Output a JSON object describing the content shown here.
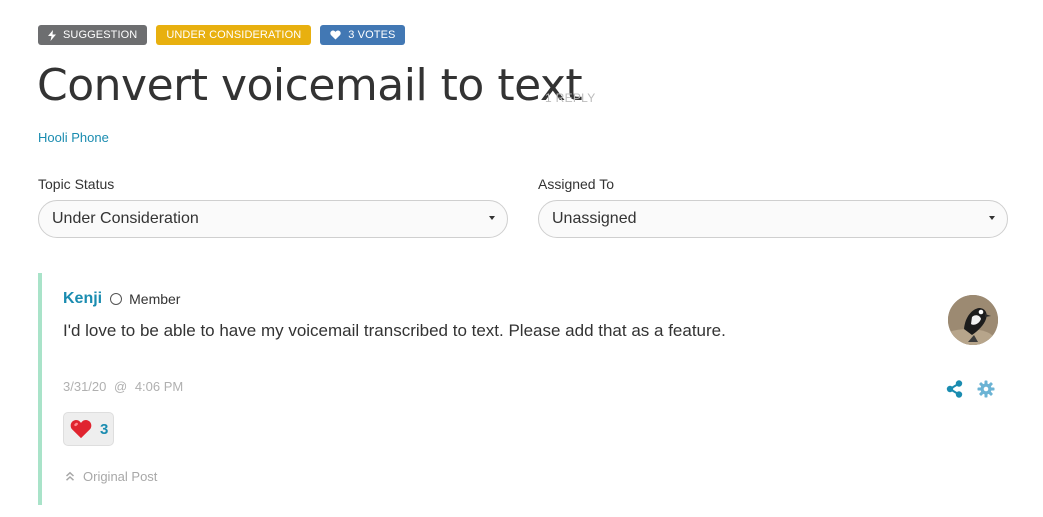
{
  "badges": {
    "suggestion": "SUGGESTION",
    "status": "UNDER CONSIDERATION",
    "votes": "3 VOTES"
  },
  "topic": {
    "title": "Convert voicemail to text",
    "reply_count": "1 REPLY",
    "product": "Hooli Phone"
  },
  "fields": {
    "status_label": "Topic Status",
    "status_value": "Under Consideration",
    "assigned_label": "Assigned To",
    "assigned_value": "Unassigned"
  },
  "post": {
    "author": "Kenji",
    "role": "Member",
    "body": "I'd love to be able to have my voicemail transcribed to text. Please add that as a feature.",
    "date": "3/31/20",
    "at": "@",
    "time": "4:06 PM",
    "reaction_emoji": "❤️",
    "reaction_count": "3",
    "original_post_label": "Original Post"
  },
  "icons": {
    "suggestion": "lightning-icon",
    "votes": "heart-icon",
    "share": "share-icon",
    "settings": "gear-icon",
    "original_post": "double-chevron-up-icon"
  },
  "colors": {
    "suggestion_badge": "#6d6e70",
    "status_badge": "#e8b00f",
    "votes_badge": "#4278b4",
    "link": "#1a8cb0",
    "rail": "#a9e3c9"
  }
}
